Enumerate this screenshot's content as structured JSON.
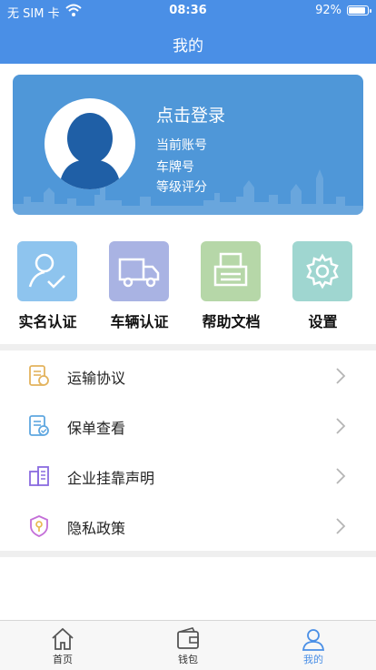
{
  "status_bar": {
    "carrier": "无 SIM 卡",
    "time": "08:36",
    "battery": "92%"
  },
  "nav": {
    "title": "我的"
  },
  "profile": {
    "login_prompt": "点击登录",
    "account_label": "当前账号",
    "plate_label": "车牌号",
    "rating_label": "等级评分"
  },
  "tiles": [
    {
      "label": "实名认证",
      "icon": "user-check-icon",
      "color": "#8ec4ee"
    },
    {
      "label": "车辆认证",
      "icon": "truck-icon",
      "color": "#a9b3e3"
    },
    {
      "label": "帮助文档",
      "icon": "printer-icon",
      "color": "#b6d7a8"
    },
    {
      "label": "设置",
      "icon": "gear-icon",
      "color": "#9fd6d0"
    }
  ],
  "menu": [
    {
      "label": "运输协议",
      "icon": "document-icon"
    },
    {
      "label": "保单查看",
      "icon": "policy-icon"
    },
    {
      "label": "企业挂靠声明",
      "icon": "building-icon"
    },
    {
      "label": "隐私政策",
      "icon": "shield-key-icon"
    }
  ],
  "tabbar": {
    "items": [
      {
        "label": "首页",
        "icon": "home-icon"
      },
      {
        "label": "钱包",
        "icon": "wallet-icon"
      },
      {
        "label": "我的",
        "icon": "user-icon"
      }
    ],
    "active": 2
  },
  "colors": {
    "primary": "#4a8fe6",
    "card": "#4f97d8",
    "separator": "#efefef"
  }
}
